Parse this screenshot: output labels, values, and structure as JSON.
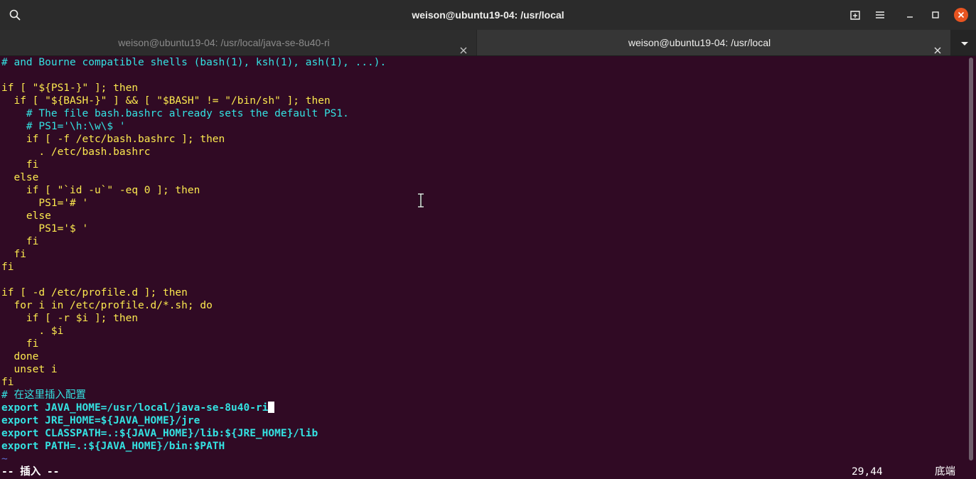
{
  "window": {
    "title": "weison@ubuntu19-04: /usr/local"
  },
  "tabs": [
    {
      "label": "weison@ubuntu19-04: /usr/local/java-se-8u40-ri",
      "active": false
    },
    {
      "label": "weison@ubuntu19-04: /usr/local",
      "active": true
    }
  ],
  "editor": {
    "lines": [
      "# and Bourne compatible shells (bash(1), ksh(1), ash(1), ...).",
      "",
      "if [ \"${PS1-}\" ]; then",
      "  if [ \"${BASH-}\" ] && [ \"$BASH\" != \"/bin/sh\" ]; then",
      "    # The file bash.bashrc already sets the default PS1.",
      "    # PS1='\\h:\\w\\$ '",
      "    if [ -f /etc/bash.bashrc ]; then",
      "      . /etc/bash.bashrc",
      "    fi",
      "  else",
      "    if [ \"`id -u`\" -eq 0 ]; then",
      "      PS1='# '",
      "    else",
      "      PS1='$ '",
      "    fi",
      "  fi",
      "fi",
      "",
      "if [ -d /etc/profile.d ]; then",
      "  for i in /etc/profile.d/*.sh; do",
      "    if [ -r $i ]; then",
      "      . $i",
      "    fi",
      "  done",
      "  unset i",
      "fi",
      "# 在这里插入配置",
      "export JAVA_HOME=/usr/local/java-se-8u40-ri",
      "export JRE_HOME=${JAVA_HOME}/jre",
      "export CLASSPATH=.:${JAVA_HOME}/lib:${JRE_HOME}/lib",
      "export PATH=.:${JAVA_HOME}/bin:$PATH",
      "~"
    ],
    "mode": "-- 插入 --",
    "position": "29,44",
    "scroll_position": "底端"
  },
  "colors": {
    "background": "#300a24",
    "comment": "#34e2e2",
    "keyword": "#fce94f",
    "number": "#ad7fa8",
    "close_button": "#e95420"
  },
  "icons": [
    "search-icon",
    "new-tab-icon",
    "menu-icon",
    "minimize-icon",
    "maximize-icon",
    "close-icon",
    "tab-close-icon",
    "dropdown-icon",
    "text-cursor-icon"
  ]
}
